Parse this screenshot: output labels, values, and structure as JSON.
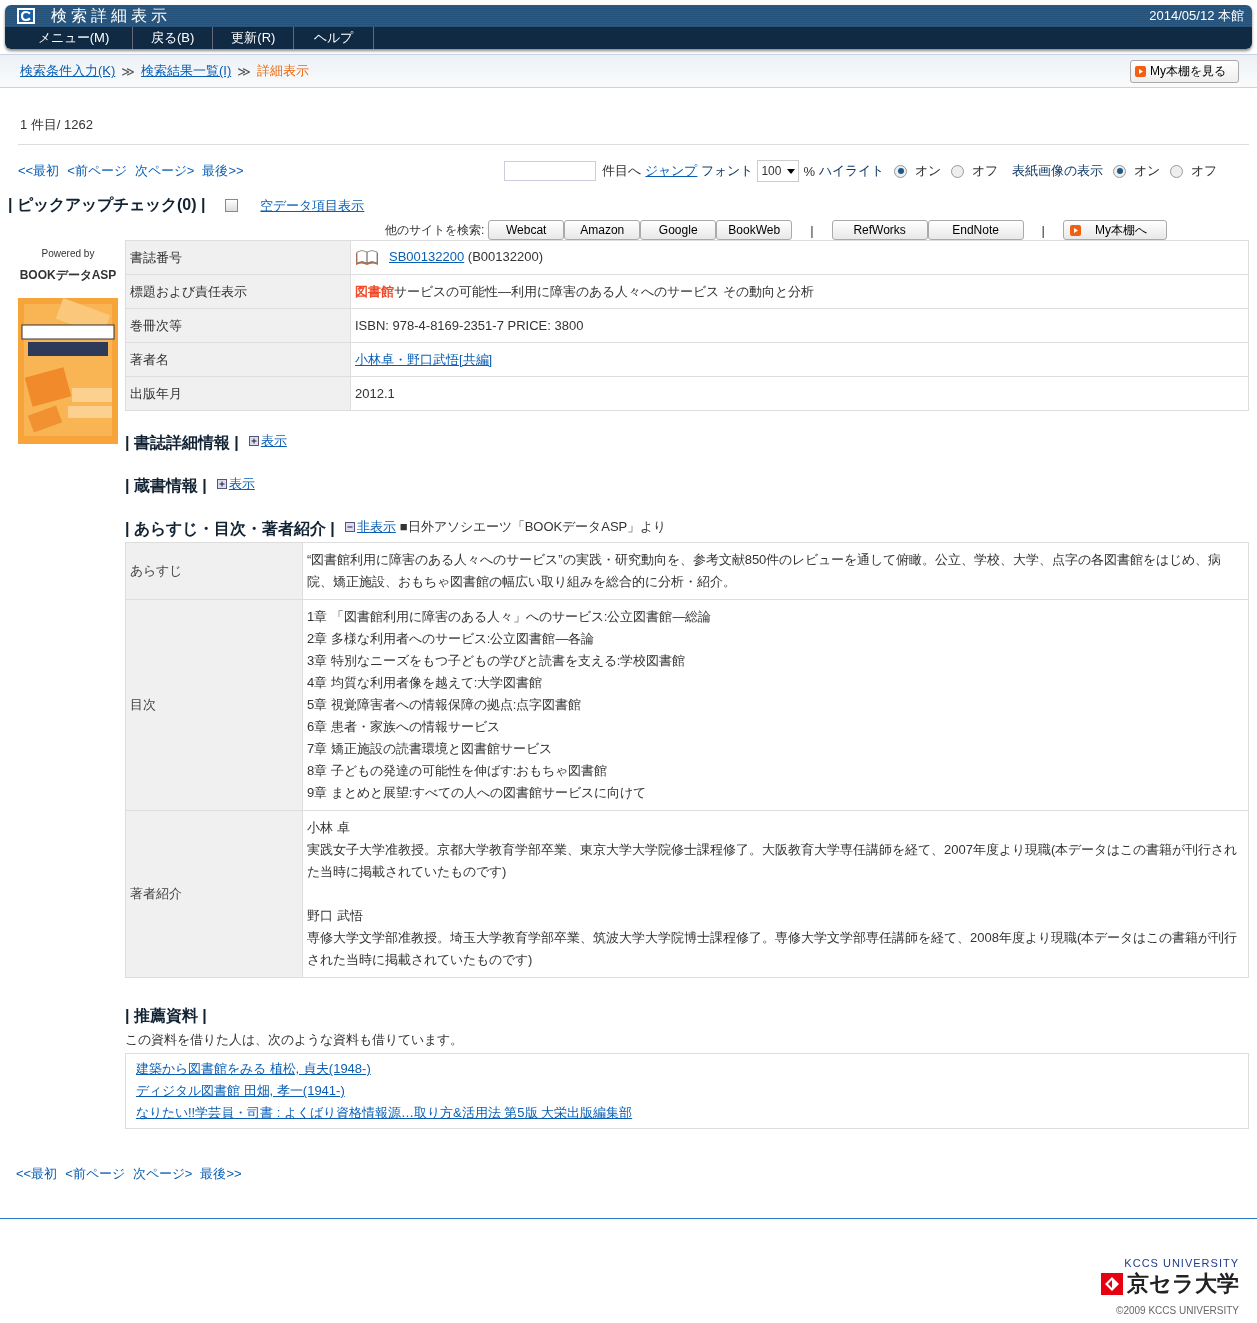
{
  "window": {
    "title": "検索詳細表示",
    "date": "2014/05/12 本館"
  },
  "menu": [
    {
      "label": "メニュー(M)"
    },
    {
      "label": "戻る(B)"
    },
    {
      "label": "更新(R)"
    },
    {
      "label": "ヘルプ"
    }
  ],
  "breadcrumb": [
    {
      "label": "検索条件入力(K)",
      "kind": "link"
    },
    {
      "label": "≫",
      "kind": "separator"
    },
    {
      "label": "検索結果一覧(I)",
      "kind": "link"
    },
    {
      "label": "≫",
      "kind": "separator"
    },
    {
      "label": "詳細表示",
      "kind": "current"
    }
  ],
  "my_shelf_button": "My本棚を見る",
  "record_position": "1 件目/ 1262",
  "pager_top": [
    "<<最初",
    "<前ページ",
    "次ページ>",
    "最後>>"
  ],
  "pager_bottom": [
    "<<最初",
    "<前ページ",
    "次ページ>",
    "最後>>"
  ],
  "jump": {
    "suffix": "件目へ",
    "button": "ジャンプ"
  },
  "font": {
    "label": "フォント",
    "value": "100",
    "unit": "%"
  },
  "highlight": {
    "label": "ハイライト",
    "options": [
      {
        "label": "オン",
        "selected": true
      },
      {
        "label": "オフ",
        "selected": false
      }
    ]
  },
  "cover_display": {
    "label": "表紙画像の表示",
    "options": [
      {
        "label": "オン",
        "selected": true
      },
      {
        "label": "オフ",
        "selected": false
      }
    ]
  },
  "pickup": {
    "label": "| ピックアップチェック(0) |",
    "checked": false,
    "empty_fields_link": "空データ項目表示"
  },
  "toolbar": [
    {
      "kind": "label",
      "label": "他のサイトを検索:"
    },
    {
      "kind": "button",
      "label": "Webcat"
    },
    {
      "kind": "button",
      "label": "Amazon"
    },
    {
      "kind": "button",
      "label": "Google"
    },
    {
      "kind": "button",
      "label": "BookWeb"
    },
    {
      "kind": "separator",
      "label": "|"
    },
    {
      "kind": "export",
      "label": "RefWorks"
    },
    {
      "kind": "export",
      "label": "EndNote"
    },
    {
      "kind": "separator",
      "label": "|"
    },
    {
      "kind": "shelf",
      "label": "My本棚へ"
    }
  ],
  "powered_by": {
    "line1": "Powered by",
    "line2": "BOOKデータASP"
  },
  "cover": {
    "kind": "picture"
  },
  "bib": [
    {
      "label": "書誌番号",
      "kind": "id",
      "link": "SB00132200",
      "note": "(B00132200)"
    },
    {
      "label": "標題および責任表示",
      "kind": "title",
      "segments": [
        {
          "text": "図書館",
          "highlighted": true
        },
        {
          "text": "サービスの可能性―利用に障害のある人々へのサービス その動向と分析",
          "highlighted": false
        }
      ]
    },
    {
      "label": "巻冊次等",
      "kind": "text",
      "value": "ISBN: 978-4-8169-2351-7   PRICE: 3800"
    },
    {
      "label": "著者名",
      "kind": "link",
      "value": "小林卓・野口武悟[共編]"
    },
    {
      "label": "出版年月",
      "kind": "text",
      "value": "2012.1"
    }
  ],
  "sections": [
    {
      "title": "| 書誌詳細情報 |",
      "toggle": "表示",
      "expanded": false
    },
    {
      "title": "| 蔵書情報 |",
      "toggle": "表示",
      "expanded": false
    }
  ],
  "summary_section": {
    "title": "| あらすじ・目次・著者紹介 |",
    "toggle": "非表示",
    "expanded": true,
    "source": "■日外アソシエーツ「BOOKデータASP」より",
    "rows": [
      {
        "label": "あらすじ",
        "lines": [
          "“図書館利用に障害のある人々へのサービス”の実践・研究動向を、参考文献850件のレビューを通して俯瞰。公立、学校、大学、点字の各図書館をはじめ、病院、矯正施設、おもちゃ図書館の幅広い取り組みを総合的に分析・紹介。"
        ]
      },
      {
        "label": "目次",
        "lines": [
          "1章 「図書館利用に障害のある人々」へのサービス:公立図書館―総論",
          "2章 多様な利用者へのサービス:公立図書館―各論",
          "3章 特別なニーズをもつ子どもの学びと読書を支える:学校図書館",
          "4章 均質な利用者像を越えて:大学図書館",
          "5章 視覚障害者への情報保障の拠点:点字図書館",
          "6章 患者・家族への情報サービス",
          "7章 矯正施設の読書環境と図書館サービス",
          "8章 子どもの発達の可能性を伸ばす:おもちゃ図書館",
          "9章 まとめと展望:すべての人への図書館サービスに向けて"
        ]
      },
      {
        "label": "著者紹介",
        "authors": [
          {
            "name": "小林 卓",
            "bio": "実践女子大学准教授。京都大学教育学部卒業、東京大学大学院修士課程修了。大阪教育大学専任講師を経て、2007年度より現職(本データはこの書籍が刊行された当時に掲載されていたものです)"
          },
          {
            "name": "野口 武悟",
            "bio": "専修大学文学部准教授。埼玉大学教育学部卒業、筑波大学大学院博士課程修了。専修大学文学部専任講師を経て、2008年度より現職(本データはこの書籍が刊行された当時に掲載されていたものです)"
          }
        ]
      }
    ]
  },
  "recommend": {
    "title": "| 推薦資料 |",
    "intro": "この資料を借りた人は、次のような資料も借りています。",
    "items": [
      "建築から図書館をみる 植松, 貞夫(1948-)",
      "ディジタル図書館 田畑, 孝一(1941-)",
      "なりたい!!学芸員・司書 : よくばり資格情報源…取り方&活用法 第5版 大栄出版編集部"
    ]
  },
  "footer": {
    "university_en": "KCCS UNIVERSITY",
    "university_ja": "京セラ大学",
    "copyright": "©2009 KCCS UNIVERSITY"
  }
}
